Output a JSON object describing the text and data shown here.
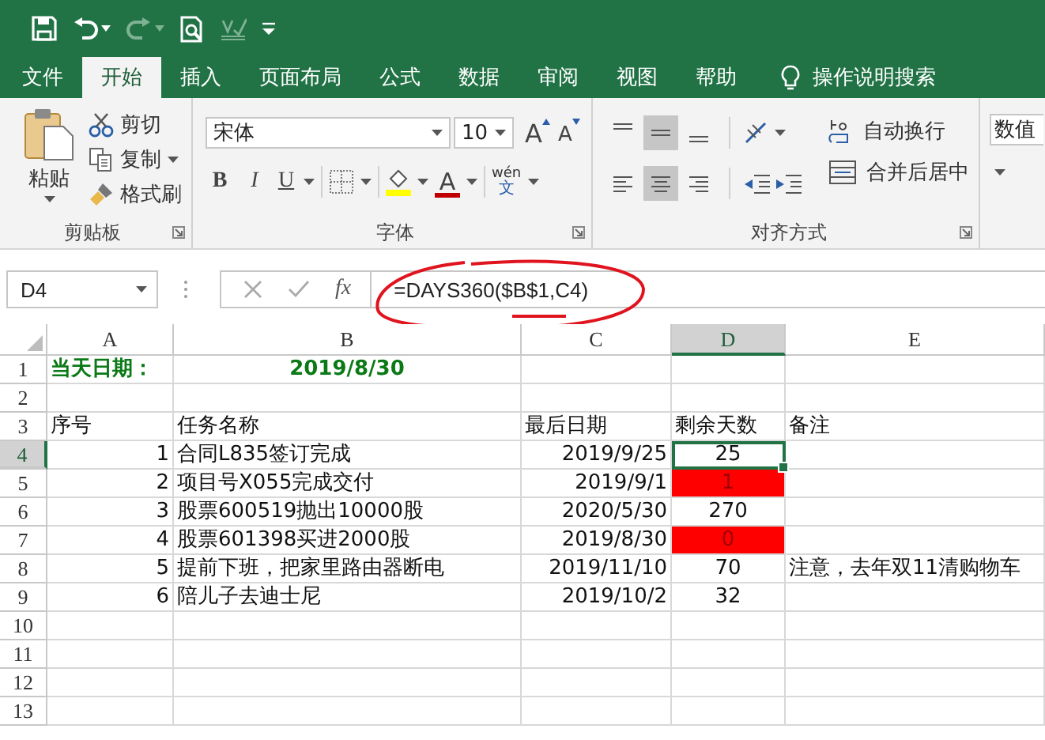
{
  "tabs": [
    {
      "label": "文件",
      "selected": false
    },
    {
      "label": "开始",
      "selected": true
    },
    {
      "label": "插入",
      "selected": false
    },
    {
      "label": "页面布局",
      "selected": false
    },
    {
      "label": "公式",
      "selected": false
    },
    {
      "label": "数据",
      "selected": false
    },
    {
      "label": "审阅",
      "selected": false
    },
    {
      "label": "视图",
      "selected": false
    },
    {
      "label": "帮助",
      "selected": false
    }
  ],
  "tell_me": "操作说明搜索",
  "ribbon": {
    "clipboard": {
      "title": "剪贴板",
      "paste": "粘贴",
      "cut": "剪切",
      "copy": "复制",
      "format_painter": "格式刷"
    },
    "font": {
      "title": "字体",
      "font_name": "宋体",
      "font_size": "10",
      "grow": "A",
      "shrink": "A",
      "bold": "B",
      "italic": "I",
      "underline": "U",
      "font_color": "A",
      "phonetic_top": "wén",
      "phonetic_bottom": "文"
    },
    "alignment": {
      "title": "对齐方式",
      "vertical": [
        {
          "selected": false
        },
        {
          "selected": true
        },
        {
          "selected": false
        }
      ],
      "horizontal": [
        {
          "selected": false
        },
        {
          "selected": true
        },
        {
          "selected": false
        }
      ],
      "wrap_text": "自动换行",
      "merge_center": "合并后居中"
    },
    "number": {
      "format": "数值"
    }
  },
  "formula_bar": {
    "name_box": "D4",
    "function_label": "fx",
    "formula": "=DAYS360($B$1,C4)"
  },
  "sheet": {
    "columns": [
      {
        "label": "A",
        "selected": false
      },
      {
        "label": "B",
        "selected": false
      },
      {
        "label": "C",
        "selected": false
      },
      {
        "label": "D",
        "selected": true
      },
      {
        "label": "E",
        "selected": false
      }
    ],
    "rows": [
      {
        "number": "1",
        "selected": false,
        "cells": [
          {
            "text": "当天日期：",
            "kind": "title"
          },
          {
            "text": "2019/8/30",
            "kind": "title-date"
          },
          null,
          null,
          null
        ]
      },
      {
        "number": "2",
        "selected": false
      },
      {
        "number": "3",
        "selected": false,
        "cells": [
          {
            "text": "序号",
            "kind": "text"
          },
          {
            "text": "任务名称",
            "kind": "text"
          },
          {
            "text": "最后日期",
            "kind": "text"
          },
          {
            "text": "剩余天数",
            "kind": "text"
          },
          {
            "text": "备注",
            "kind": "text"
          }
        ]
      },
      {
        "number": "4",
        "selected": true,
        "cells": [
          {
            "text": "1",
            "kind": "number"
          },
          {
            "text": "合同L835签订完成",
            "kind": "text"
          },
          {
            "text": "2019/9/25",
            "kind": "number"
          },
          {
            "text": "25",
            "kind": "days",
            "alert": false,
            "selected": true
          },
          null
        ]
      },
      {
        "number": "5",
        "selected": false,
        "cells": [
          {
            "text": "2",
            "kind": "number"
          },
          {
            "text": "项目号X055完成交付",
            "kind": "text"
          },
          {
            "text": "2019/9/1",
            "kind": "number"
          },
          {
            "text": "1",
            "kind": "days",
            "alert": true,
            "selected": false
          },
          null
        ]
      },
      {
        "number": "6",
        "selected": false,
        "cells": [
          {
            "text": "3",
            "kind": "number"
          },
          {
            "text": "股票600519抛出10000股",
            "kind": "text"
          },
          {
            "text": "2020/5/30",
            "kind": "number"
          },
          {
            "text": "270",
            "kind": "days",
            "alert": false,
            "selected": false
          },
          null
        ]
      },
      {
        "number": "7",
        "selected": false,
        "cells": [
          {
            "text": "4",
            "kind": "number"
          },
          {
            "text": "股票601398买进2000股",
            "kind": "text"
          },
          {
            "text": "2019/8/30",
            "kind": "number"
          },
          {
            "text": "0",
            "kind": "days",
            "alert": true,
            "selected": false
          },
          null
        ]
      },
      {
        "number": "8",
        "selected": false,
        "cells": [
          {
            "text": "5",
            "kind": "number"
          },
          {
            "text": "提前下班，把家里路由器断电",
            "kind": "text"
          },
          {
            "text": "2019/11/10",
            "kind": "number"
          },
          {
            "text": "70",
            "kind": "days",
            "alert": false,
            "selected": false
          },
          {
            "text": "注意，去年双11清购物车",
            "kind": "text"
          }
        ]
      },
      {
        "number": "9",
        "selected": false,
        "cells": [
          {
            "text": "6",
            "kind": "number"
          },
          {
            "text": "陪儿子去迪士尼",
            "kind": "text"
          },
          {
            "text": "2019/10/2",
            "kind": "number"
          },
          {
            "text": "32",
            "kind": "days",
            "alert": false,
            "selected": false
          },
          null
        ]
      },
      {
        "number": "10",
        "selected": false
      },
      {
        "number": "11",
        "selected": false
      },
      {
        "number": "12",
        "selected": false
      },
      {
        "number": "13",
        "selected": false
      }
    ]
  }
}
